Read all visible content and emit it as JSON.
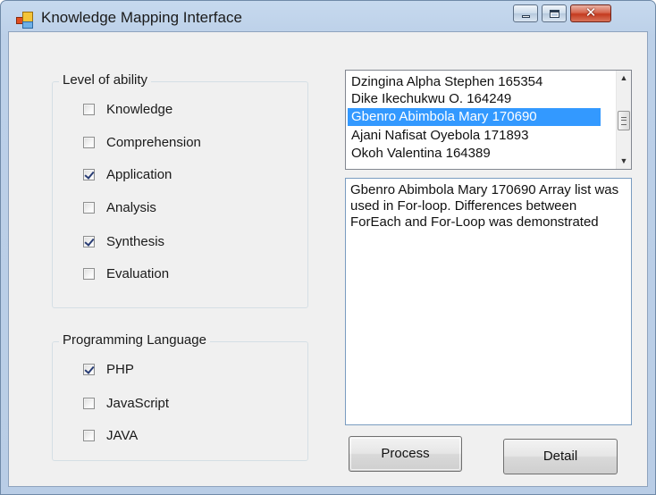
{
  "window": {
    "title": "Knowledge Mapping Interface",
    "icons": {
      "app": "app-icon",
      "minimize": "minimize-icon",
      "maximize": "maximize-icon",
      "close": "close-icon"
    }
  },
  "ability_group": {
    "title": "Level of ability",
    "items": [
      {
        "label": "Knowledge",
        "checked": false
      },
      {
        "label": "Comprehension",
        "checked": false
      },
      {
        "label": "Application",
        "checked": true
      },
      {
        "label": "Analysis",
        "checked": false
      },
      {
        "label": "Synthesis",
        "checked": true
      },
      {
        "label": "Evaluation",
        "checked": false
      }
    ]
  },
  "language_group": {
    "title": "Programming Language",
    "items": [
      {
        "label": "PHP",
        "checked": true
      },
      {
        "label": "JavaScript",
        "checked": false
      },
      {
        "label": "JAVA",
        "checked": false
      }
    ]
  },
  "student_list": {
    "items": [
      "Dzingina Alpha Stephen 165354",
      "Dike Ikechukwu O.   164249",
      "Gbenro Abimbola Mary 170690",
      "Ajani Nafisat Oyebola 171893",
      "Okoh Valentina 164389"
    ],
    "selected_index": 2
  },
  "detail_text": "Gbenro Abimbola Mary 170690 Array list was used in For-loop. Differences between ForEach and For-Loop was demonstrated",
  "buttons": {
    "process": "Process",
    "detail": "Detail"
  },
  "colors": {
    "selection": "#3399ff",
    "titlebar": "#c6d9ee",
    "close_button": "#c43a1f",
    "check_mark": "#283c74"
  }
}
